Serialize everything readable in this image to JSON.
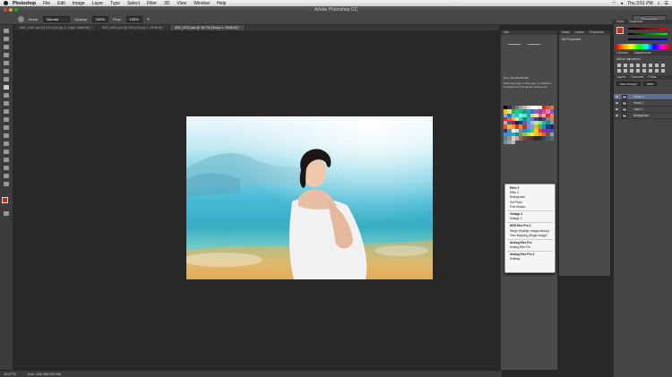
{
  "menubar": {
    "app": "Photoshop",
    "items": [
      "File",
      "Edit",
      "Image",
      "Layer",
      "Type",
      "Select",
      "Filter",
      "3D",
      "View",
      "Window",
      "Help"
    ],
    "clock": "Thu 3:51 PM"
  },
  "window": {
    "title": "Adobe Photoshop CC"
  },
  "options": {
    "mode_label": "Mode:",
    "mode_value": "Normal",
    "opacity_label": "Opacity:",
    "opacity_value": "100%",
    "flow_label": "Flow:",
    "flow_value": "100%"
  },
  "workspace": "Essentials",
  "tabs": [
    "IMG_0482.psd @ 33% (Group 1, Layer Mask/16) *",
    "IMG_0482.psd @ 33% (Group 1, RGB/16) *",
    "IMG_0472.psd @ 16.7% (Group 1, RGB/16) *"
  ],
  "status": {
    "zoom": "16.67%",
    "doc": "Doc: 135.3M/405.9M"
  },
  "info": {
    "title": "Info",
    "doc": "Doc: 135.3M/405.9M",
    "hint": "Click and drag to draw layer or selection constrained to 45 degree increments"
  },
  "properties": {
    "tabs": [
      "Mask",
      "Layers",
      "Properties"
    ],
    "message": "No Properties"
  },
  "swatch_colors": [
    "#000000",
    "#333333",
    "#555555",
    "#777777",
    "#999999",
    "#bbbbbb",
    "#dddddd",
    "#ffffff",
    "#ffffff",
    "#eeeeee",
    "#c0392b",
    "#e74c3c",
    "#e67e22",
    "#f1c40f",
    "#f7dc6f",
    "#27ae60",
    "#2ecc71",
    "#1abc9c",
    "#16a085",
    "#3498db",
    "#2980b9",
    "#9b59b6",
    "#8e44ad",
    "#e84393",
    "#fd79a8",
    "#6c5ce7",
    "#a29bfe",
    "#0984e3",
    "#74b9ff",
    "#00cec9",
    "#81ecec",
    "#55efc4",
    "#00b894",
    "#fdcb6e",
    "#ffeaa7",
    "#e17055",
    "#fab1a0",
    "#d63031",
    "#ff7675",
    "#b33939",
    "#ff5252",
    "#ffb142",
    "#ffda79",
    "#33d9b2",
    "#218c74",
    "#34ace0",
    "#706fd3",
    "#40407a",
    "#2c2c54",
    "#474787",
    "#84817a",
    "#cc8e35",
    "#ccae62",
    "#227093",
    "#b71540",
    "#0c2461",
    "#1e3799",
    "#4a69bd",
    "#6a89cc",
    "#82ccdd",
    "#b8e994",
    "#78e08f",
    "#38ada9",
    "#079992",
    "#60a3bc",
    "#e55039",
    "#f6b93b",
    "#fa983a",
    "#eb2f06",
    "#e58e26",
    "#c23616",
    "#8c7ae6",
    "#9c88ff",
    "#e1b12c",
    "#44bd32",
    "#0097e6",
    "#273c75",
    "#192a56",
    "#353b48",
    "#718093",
    "#f5f6fa",
    "#dcdde1",
    "#7f8fa6",
    "#487eb0",
    "#00a8ff",
    "#4cd137",
    "#fbc531",
    "#e84118",
    "#9c27b0",
    "#673ab7",
    "#3f51b5",
    "#2196f3",
    "#03a9f4",
    "#00bcd4",
    "#009688",
    "#4caf50",
    "#8bc34a",
    "#cddc39",
    "#ffeb3b",
    "#ffc107",
    "#ff9800",
    "#ff5722",
    "#795548",
    "#9e9e9e",
    "#607d8b",
    "#a1887f",
    "#d7ccc8",
    "#bcaaa4",
    "#8d6e63",
    "#6d4c41",
    "#5d4037",
    "#4e342e",
    "#3e2723",
    "#263238",
    "#37474f",
    "#455a64",
    "#546e7a",
    "#78909c",
    "#90a4ae",
    "#b0bec5"
  ],
  "context_menu": [
    {
      "t": "Effex 2",
      "h": true
    },
    {
      "t": "Effex 2"
    },
    {
      "t": "Background"
    },
    {
      "t": "3rd Photo"
    },
    {
      "t": "Pine Mosaic"
    },
    {
      "t": "sep"
    },
    {
      "t": "Vintage 2",
      "h": true
    },
    {
      "t": "Vintage 2"
    },
    {
      "t": "sep"
    },
    {
      "t": "HDR Efex Pro 2",
      "h": true
    },
    {
      "t": "Merge (Multiple Images Below)"
    },
    {
      "t": "Tone Mapping (Single Image)"
    },
    {
      "t": "sep"
    },
    {
      "t": "Analog Efex Pro",
      "h": true
    },
    {
      "t": "Analog Efex Pro"
    },
    {
      "t": "sep"
    },
    {
      "t": "Analog Efex Pro 2",
      "h": true
    },
    {
      "t": "Settings"
    }
  ],
  "right": {
    "color_tabs": [
      "Color",
      "Swatches"
    ],
    "adj_tabs": [
      "Libraries",
      "Adjustments"
    ],
    "adj_label": "Add an adjustment",
    "layer_tabs": [
      "Layers",
      "Channels",
      "Paths"
    ],
    "blend": "Pass Through",
    "opacity": "100%",
    "layers": [
      {
        "name": "Group 3",
        "sel": true
      },
      {
        "name": "Group 2",
        "sel": false
      },
      {
        "name": "Layer 1",
        "sel": false
      },
      {
        "name": "Background",
        "sel": false
      }
    ]
  }
}
